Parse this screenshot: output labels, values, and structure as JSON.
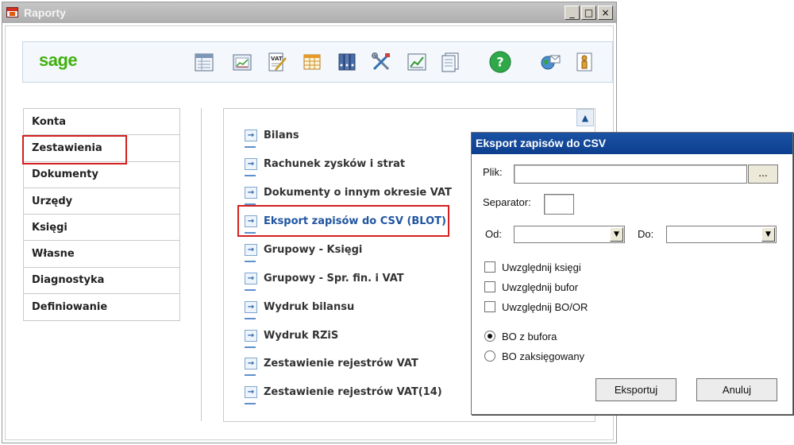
{
  "window": {
    "title": "Raporty",
    "minimize": "_",
    "maximize": "□",
    "close": "×"
  },
  "toolbar": {
    "logo": "sage",
    "icons": [
      "ledger-icon",
      "chart-window-icon",
      "vat-document-icon",
      "table-icon",
      "binders-icon",
      "tools-icon",
      "line-chart-icon",
      "pages-icon",
      "help-icon",
      "globe-mail-icon",
      "person-info-icon"
    ],
    "help_glyph": "?"
  },
  "nav": {
    "items": [
      {
        "label": "Konta"
      },
      {
        "label": "Zestawienia",
        "active": true
      },
      {
        "label": "Dokumenty"
      },
      {
        "label": "Urzędy"
      },
      {
        "label": "Księgi"
      },
      {
        "label": "Własne"
      },
      {
        "label": "Diagnostyka"
      },
      {
        "label": "Definiowanie"
      }
    ]
  },
  "reports": {
    "items": [
      {
        "label": "Bilans"
      },
      {
        "label": "Rachunek zysków i strat"
      },
      {
        "label": "Dokumenty o innym okresie VAT"
      },
      {
        "label": "Eksport zapisów do CSV (BLOT)",
        "highlight": true
      },
      {
        "label": "Grupowy - Księgi"
      },
      {
        "label": "Grupowy - Spr. fin. i VAT"
      },
      {
        "label": "Wydruk bilansu"
      },
      {
        "label": "Wydruk RZiS"
      },
      {
        "label": "Zestawienie rejestrów VAT"
      },
      {
        "label": "Zestawienie rejestrów VAT(14)"
      }
    ],
    "arrow_glyph": "→",
    "scroll_glyph": "▲"
  },
  "dialog": {
    "title": "Eksport zapisów do CSV",
    "file_label": "Plik:",
    "file_value": "",
    "browse_label": "...",
    "separator_label": "Separator:",
    "separator_value": "",
    "from_label": "Od:",
    "to_label": "Do:",
    "dropdown_glyph": "▼",
    "checkboxes": [
      {
        "label": "Uwzględnij księgi",
        "checked": false
      },
      {
        "label": "Uwzględnij bufor",
        "checked": false
      },
      {
        "label": "Uwzględnij BO/OR",
        "checked": false
      }
    ],
    "radios": [
      {
        "label": "BO z bufora",
        "selected": true
      },
      {
        "label": "BO zaksięgowany",
        "selected": false
      }
    ],
    "export_button": "Eksportuj",
    "cancel_button": "Anuluj"
  }
}
